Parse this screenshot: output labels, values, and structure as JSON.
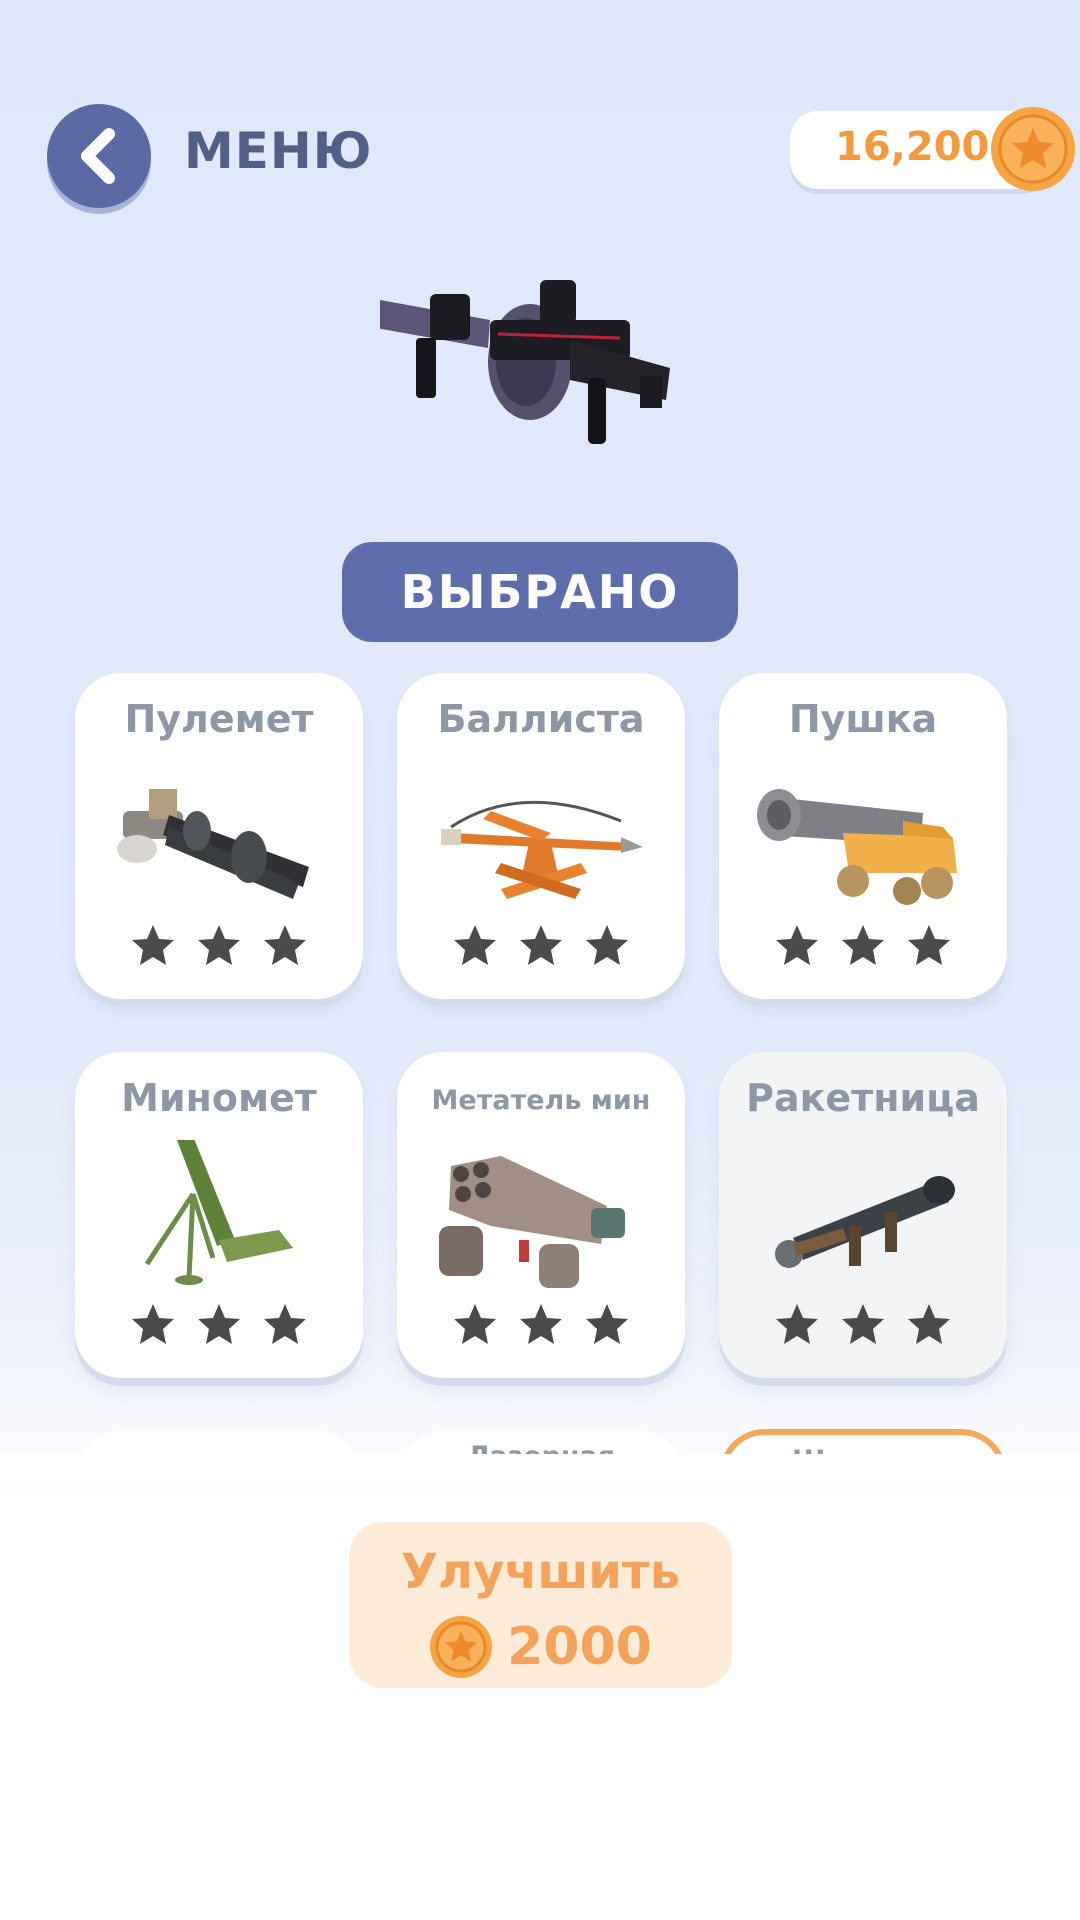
{
  "header": {
    "back_icon": "chevron-left-icon",
    "menu_label": "МЕНЮ",
    "coins": "16,200",
    "coin_icon": "coin-star-icon"
  },
  "hero": {
    "weapon_icon": "grenade-launcher-icon",
    "selected_label": "ВЫБРАНО"
  },
  "weapons": [
    {
      "name": "Пулемет",
      "icon": "minigun-icon",
      "stars_total": 3,
      "stars_filled": 3
    },
    {
      "name": "Баллиста",
      "icon": "ballista-icon",
      "stars_total": 3,
      "stars_filled": 3
    },
    {
      "name": "Пушка",
      "icon": "cannon-icon",
      "stars_total": 3,
      "stars_filled": 3
    },
    {
      "name": "Миномет",
      "icon": "mortar-icon",
      "stars_total": 3,
      "stars_filled": 3
    },
    {
      "name": "Метатель мин",
      "icon": "mine-launcher-icon",
      "stars_total": 3,
      "stars_filled": 3
    },
    {
      "name": "Ракетница",
      "icon": "rocket-launcher-icon",
      "stars_total": 3,
      "stars_filled": 3
    }
  ],
  "partial_row": [
    {
      "name": ""
    },
    {
      "name": "Лазерная"
    },
    {
      "name": "Шаровая"
    }
  ],
  "upgrade": {
    "label": "Улучшить",
    "cost": "2000",
    "coin_icon": "coin-star-icon"
  },
  "colors": {
    "accent_blue": "#5e6ead",
    "coin_orange": "#f39a3d",
    "upgrade_bg": "#feecd9",
    "star_dark": "#4a4a4a"
  }
}
